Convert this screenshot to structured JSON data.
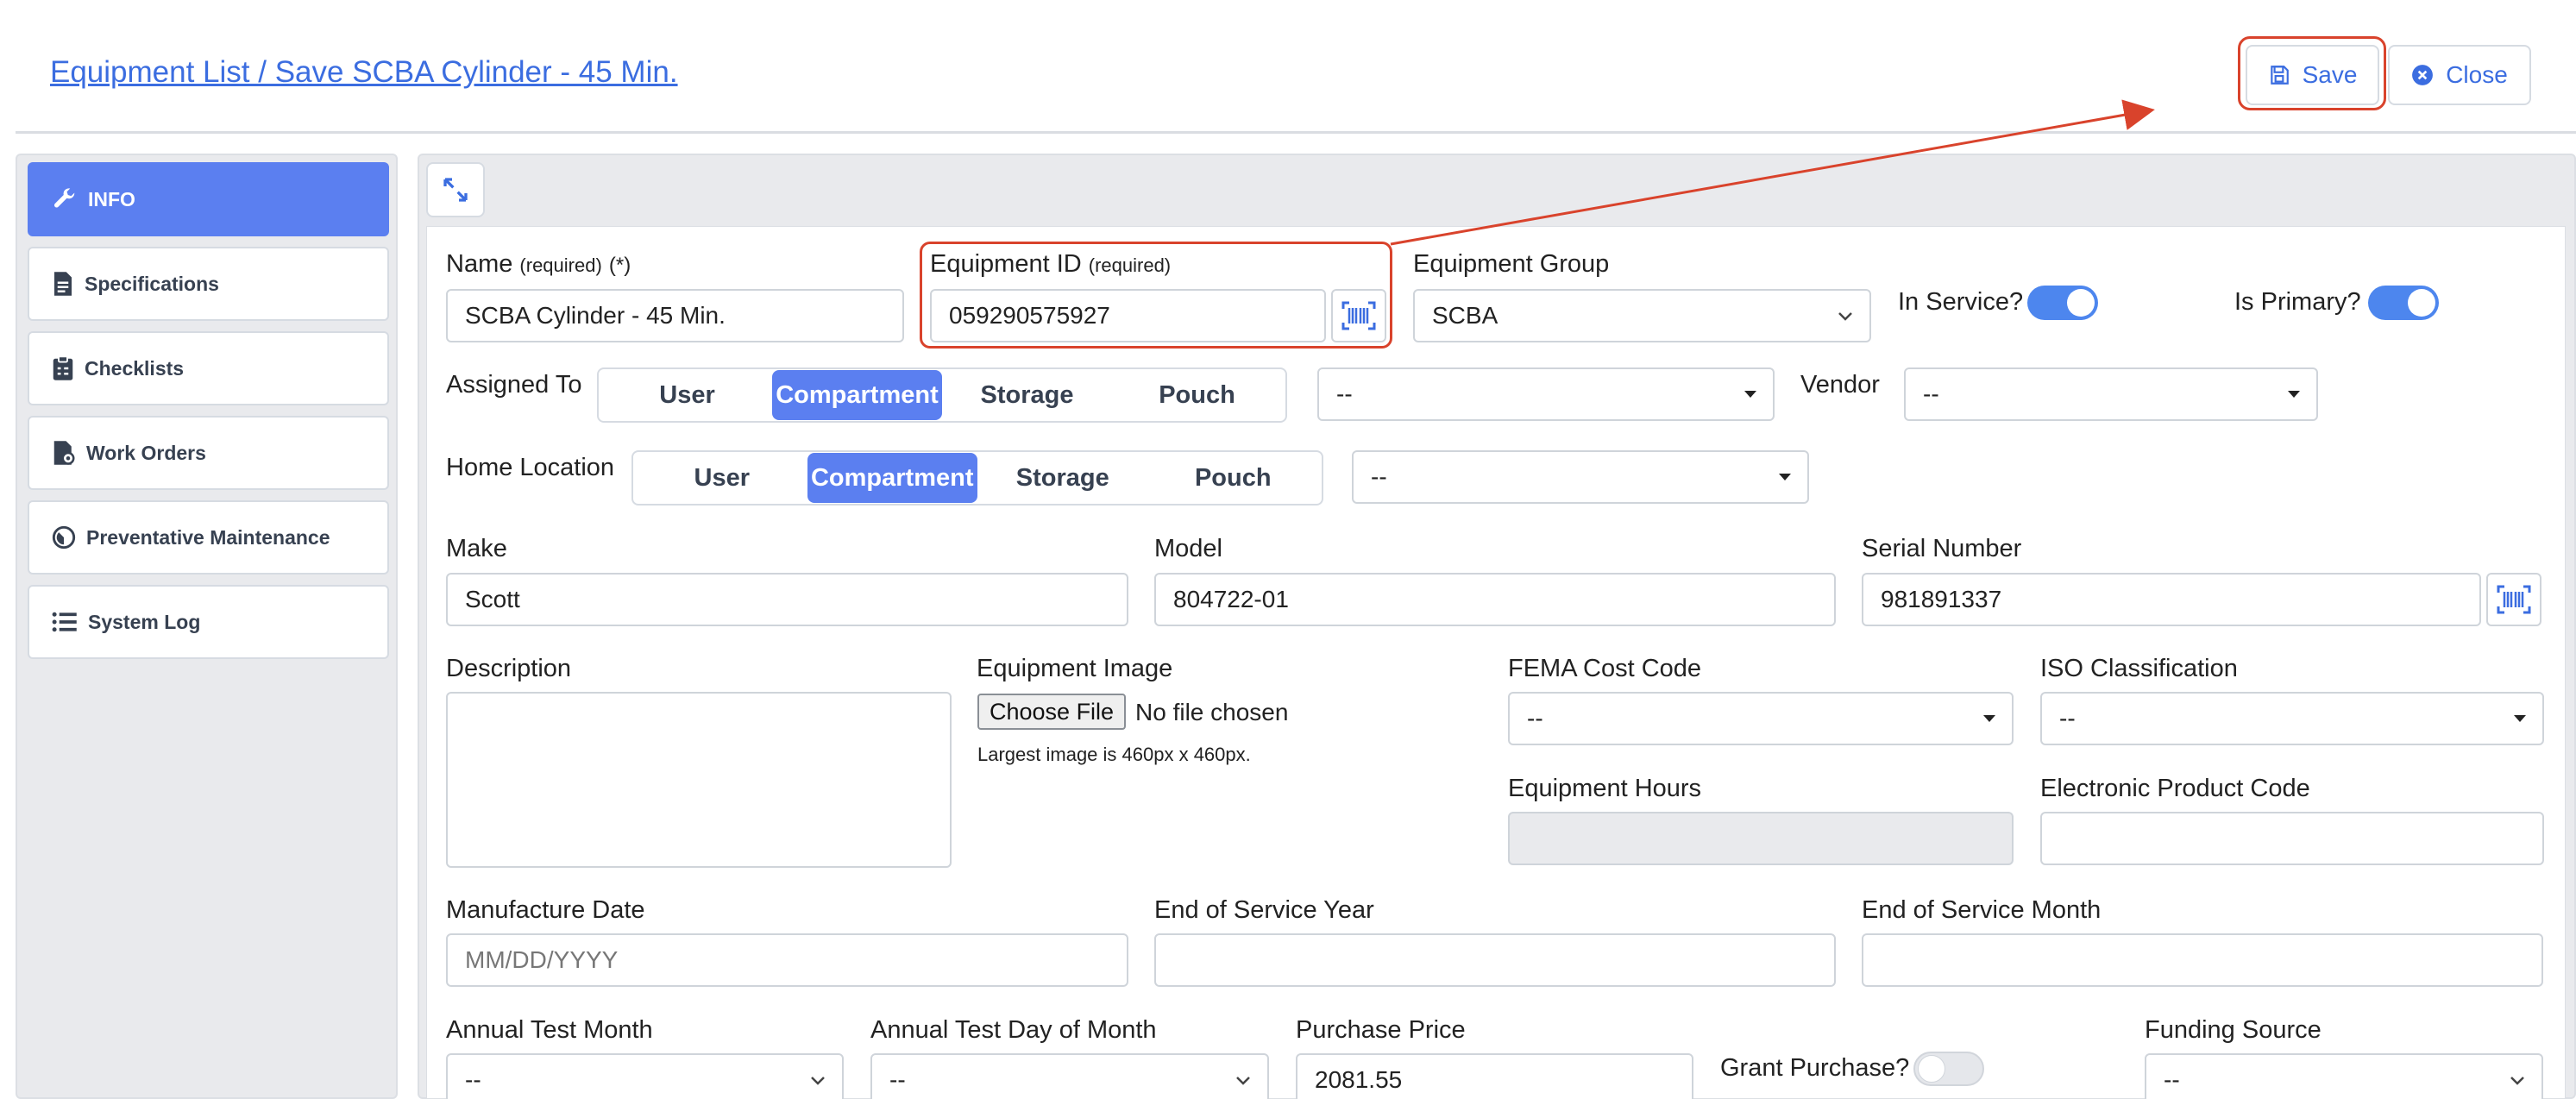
{
  "header": {
    "breadcrumb": "Equipment List / Save SCBA Cylinder - 45 Min.",
    "save_label": "Save",
    "close_label": "Close"
  },
  "sidebar": {
    "items": [
      {
        "label": "INFO",
        "icon": "wrench-icon",
        "active": true
      },
      {
        "label": "Specifications",
        "icon": "document-icon"
      },
      {
        "label": "Checklists",
        "icon": "clipboard-icon"
      },
      {
        "label": "Work Orders",
        "icon": "document-gear-icon"
      },
      {
        "label": "Preventative Maintenance",
        "icon": "gauge-icon"
      },
      {
        "label": "System Log",
        "icon": "list-icon"
      }
    ]
  },
  "form": {
    "name_label": "Name",
    "name_required": "(required)",
    "name_star": "(*)",
    "name_value": "SCBA Cylinder - 45 Min.",
    "equipment_id_label": "Equipment ID",
    "equipment_id_required": "(required)",
    "equipment_id_value": "059290575927",
    "equipment_group_label": "Equipment Group",
    "equipment_group_value": "SCBA",
    "in_service_label": "In Service?",
    "is_primary_label": "Is Primary?",
    "assigned_to_label": "Assigned To",
    "assigned_options": [
      "User",
      "Compartment",
      "Storage",
      "Pouch"
    ],
    "assigned_selected": "Compartment",
    "assigned_select_value": "--",
    "vendor_label": "Vendor",
    "vendor_value": "--",
    "home_location_label": "Home Location",
    "home_options": [
      "User",
      "Compartment",
      "Storage",
      "Pouch"
    ],
    "home_selected": "Compartment",
    "home_select_value": "--",
    "make_label": "Make",
    "make_value": "Scott",
    "model_label": "Model",
    "model_value": "804722-01",
    "serial_label": "Serial Number",
    "serial_value": "981891337",
    "description_label": "Description",
    "image_label": "Equipment Image",
    "choose_file_label": "Choose File",
    "no_file_text": "No file chosen",
    "image_hint": "Largest image is 460px x 460px.",
    "fema_label": "FEMA Cost Code",
    "fema_value": "--",
    "iso_label": "ISO Classification",
    "iso_value": "--",
    "hours_label": "Equipment Hours",
    "epc_label": "Electronic Product Code",
    "manufacture_label": "Manufacture Date",
    "manufacture_placeholder": "MM/DD/YYYY",
    "eos_year_label": "End of Service Year",
    "eos_month_label": "End of Service Month",
    "annual_month_label": "Annual Test Month",
    "annual_month_value": "--",
    "annual_day_label": "Annual Test Day of Month",
    "annual_day_value": "--",
    "price_label": "Purchase Price",
    "price_value": "2081.55",
    "grant_label": "Grant Purchase?",
    "funding_label": "Funding Source",
    "funding_value": "--"
  },
  "colors": {
    "accent": "#5b7ff0",
    "link": "#3b6de0",
    "annotation": "#d9432c",
    "toggle_on": "#4d86ee"
  }
}
